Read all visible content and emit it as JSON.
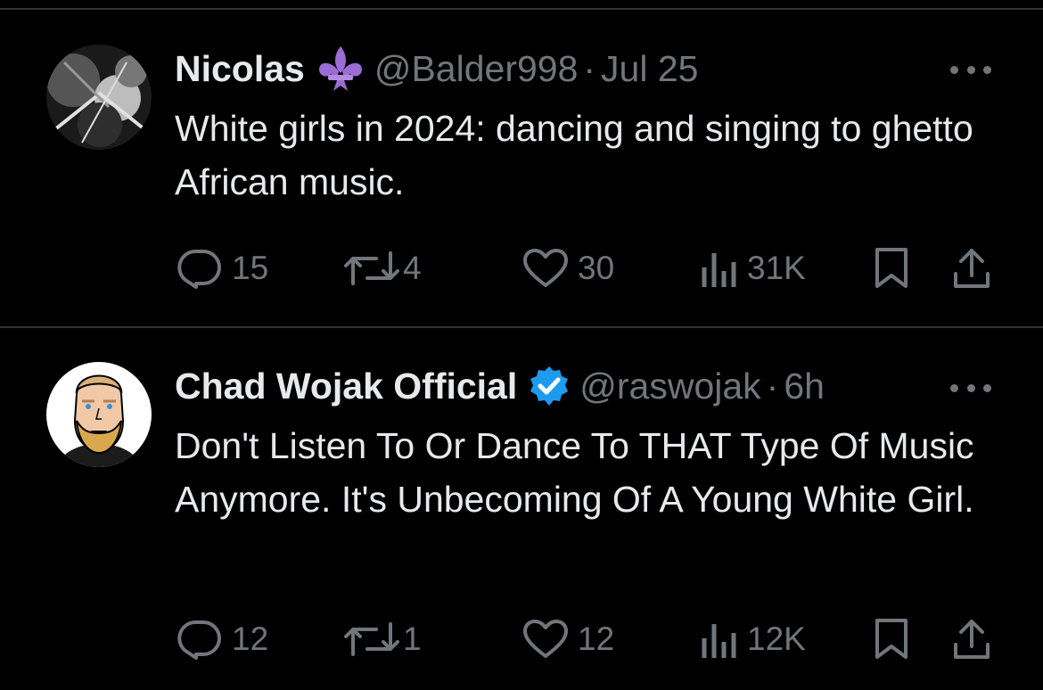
{
  "tweets": [
    {
      "name": "Nicolas",
      "badge": "fleur-de-lis-emoji",
      "handle": "@Balder998",
      "separator": "·",
      "time": "Jul 25",
      "text": "White girls in 2024: dancing and singing to ghetto African music.",
      "replies": "15",
      "reposts": "4",
      "likes": "30",
      "views": "31K"
    },
    {
      "name": "Chad Wojak Official",
      "badge": "verified-badge",
      "handle": "@raswojak",
      "separator": "·",
      "time": "6h",
      "text": "Don't Listen To Or Dance To THAT Type Of Music Anymore. It's Unbecoming Of A Young White Girl.",
      "replies": "12",
      "reposts": "1",
      "likes": "12",
      "views": "12K"
    }
  ],
  "colors": {
    "background": "#000000",
    "text": "#e7e9ea",
    "secondary": "#71767b",
    "divider": "#2f3336",
    "verified": "#1d9bf0",
    "fleur": "#9b6bd6"
  },
  "icons": [
    "reply-icon",
    "repost-icon",
    "like-icon",
    "views-icon",
    "bookmark-icon",
    "share-icon",
    "more-icon"
  ]
}
